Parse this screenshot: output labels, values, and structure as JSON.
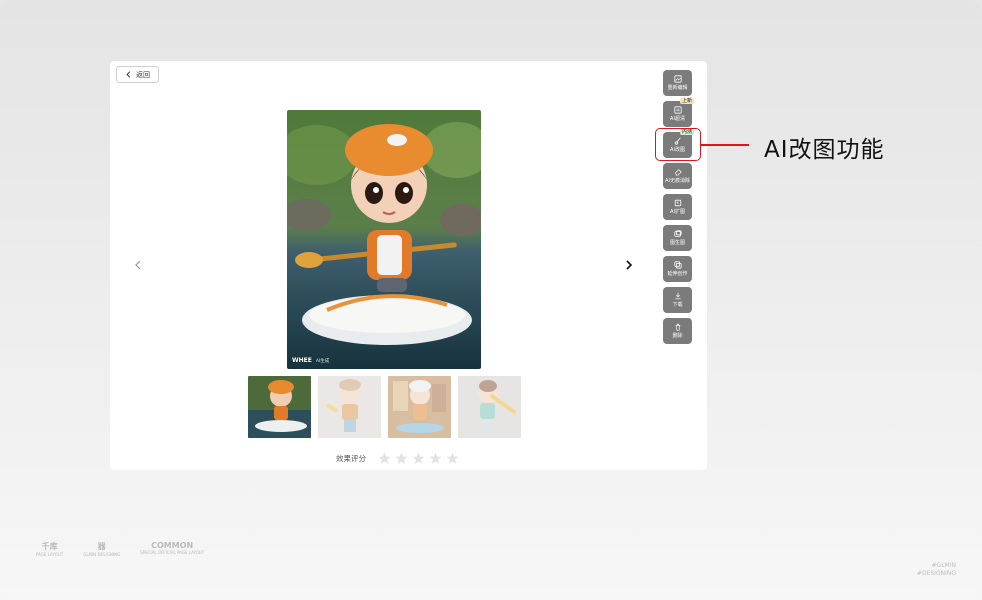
{
  "header": {
    "back_label": "返回"
  },
  "viewer": {
    "watermark": "WHEE",
    "watermark_sub": "AI生成",
    "prev_icon": "chevron-left-icon",
    "next_icon": "chevron-right-icon"
  },
  "thumbnails": [
    {
      "name": "thumb-1",
      "selected": true
    },
    {
      "name": "thumb-2",
      "selected": false
    },
    {
      "name": "thumb-3",
      "selected": false
    },
    {
      "name": "thumb-4",
      "selected": false
    }
  ],
  "rating": {
    "label": "效果评分",
    "stars_filled": 0,
    "stars_total": 5
  },
  "toolbar": {
    "items": [
      {
        "label": "重新编辑",
        "icon": "image-edit-icon"
      },
      {
        "label": "AI超清",
        "icon": "hd-icon",
        "badge": "上新"
      },
      {
        "label": "AI改图",
        "icon": "brush-icon",
        "badge": "内测"
      },
      {
        "label": "AI无痕消除",
        "icon": "eraser-icon"
      },
      {
        "label": "AI扩图",
        "icon": "expand-icon"
      },
      {
        "label": "图生图",
        "icon": "images-icon"
      },
      {
        "label": "延伸创作",
        "icon": "copy-icon"
      },
      {
        "label": "下载",
        "icon": "download-icon"
      },
      {
        "label": "删除",
        "icon": "trash-icon"
      }
    ]
  },
  "annotation": {
    "callout": "AI改图功能",
    "color": "#e0141e"
  },
  "footer": {
    "logos": [
      {
        "mark": "千库",
        "caption": "PAGE LAYOUT"
      },
      {
        "mark": "器",
        "caption": "GLMIN DESIGNING"
      },
      {
        "mark": "COMMON",
        "caption": "SPECIAL OFFICIAL PAGE LAYOUT"
      }
    ],
    "signature_line1": "#GLMIN",
    "signature_line2": "#DESIGNING"
  },
  "colors": {
    "toolbar_bg": "#7b7b7b",
    "card_bg": "#ffffff",
    "highlight": "#e0141e"
  }
}
